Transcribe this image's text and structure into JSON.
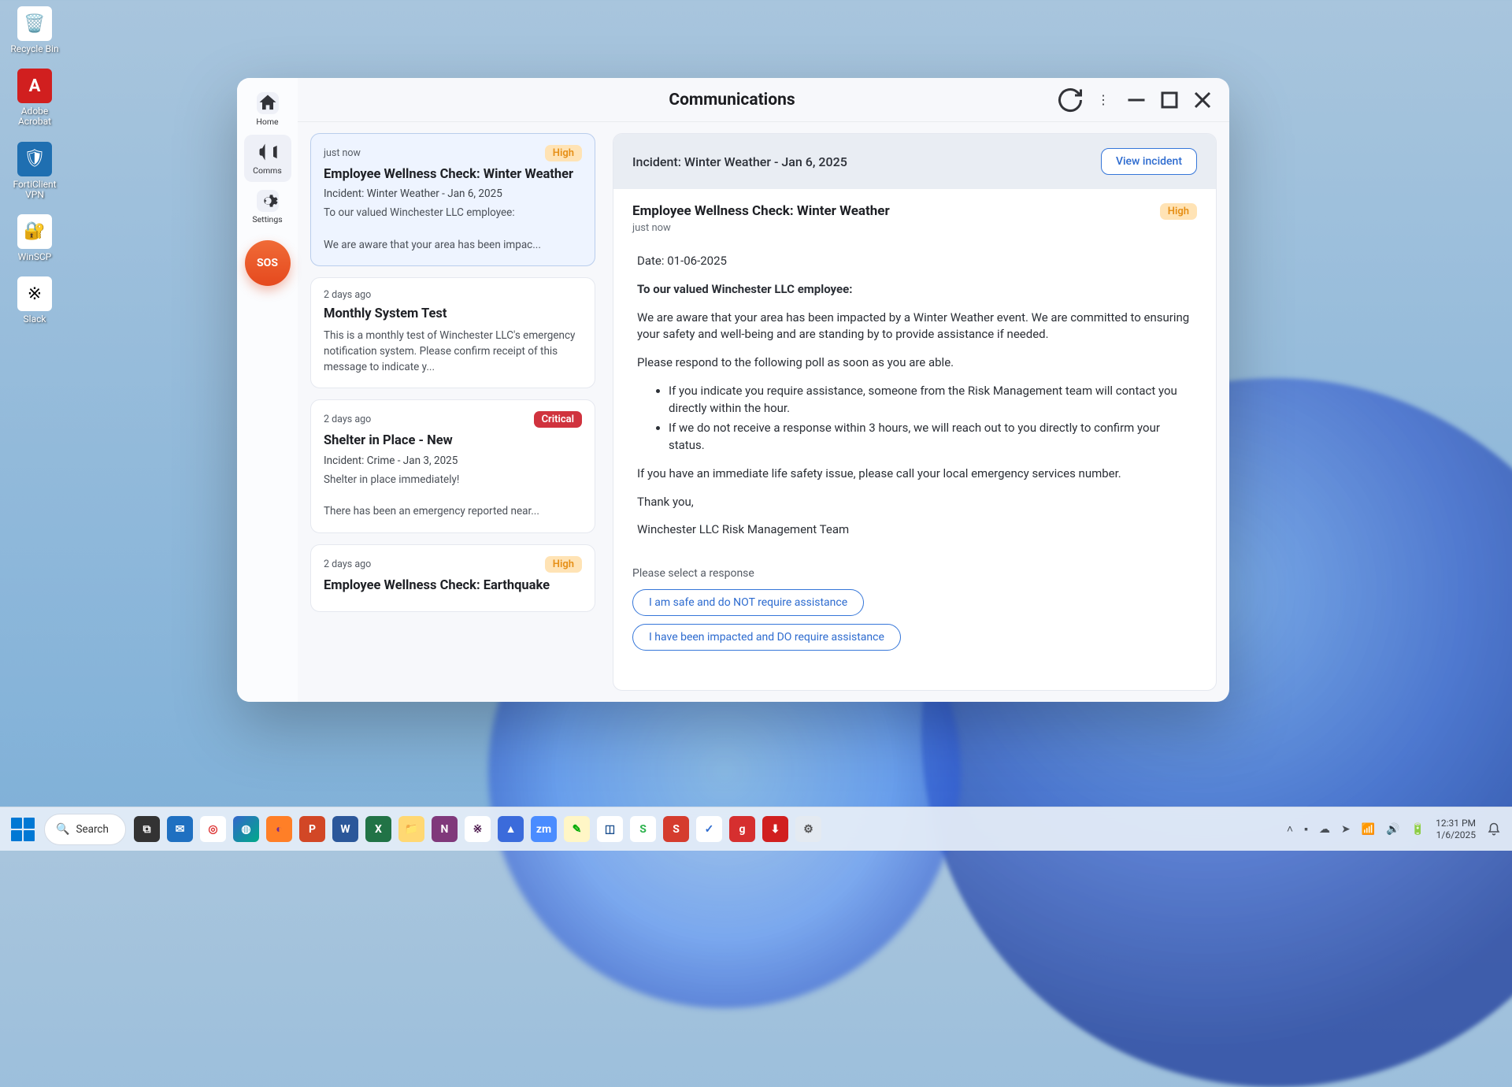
{
  "desktop": {
    "icons": [
      {
        "name": "recycle-bin",
        "label": "Recycle Bin"
      },
      {
        "name": "adobe-acrobat",
        "label": "Adobe Acrobat"
      },
      {
        "name": "forticlient-vpn",
        "label": "FortiClient VPN"
      },
      {
        "name": "winscp",
        "label": "WinSCP"
      },
      {
        "name": "slack",
        "label": "Slack"
      }
    ]
  },
  "window": {
    "title": "Communications",
    "sidebar": {
      "items": [
        {
          "name": "home",
          "label": "Home"
        },
        {
          "name": "comms",
          "label": "Comms"
        },
        {
          "name": "settings",
          "label": "Settings"
        }
      ],
      "sos": "SOS"
    },
    "list": [
      {
        "time": "just now",
        "badge": "High",
        "badge_level": "high",
        "title": "Employee Wellness Check: Winter Weather",
        "subtitle": "Incident: Winter Weather - Jan 6, 2025",
        "body": "To our valued Winchester LLC employee:\n\nWe are aware that your area has been impac...",
        "selected": true
      },
      {
        "time": "2 days ago",
        "badge": "",
        "badge_level": "",
        "title": "Monthly System Test",
        "subtitle": "",
        "body": "This is a monthly test of Winchester LLC's emergency notification system. Please confirm receipt of this message to indicate y...",
        "selected": false
      },
      {
        "time": "2 days ago",
        "badge": "Critical",
        "badge_level": "critical",
        "title": "Shelter in Place - New",
        "subtitle": "Incident: Crime - Jan 3, 2025",
        "body": "Shelter in place immediately!\n\nThere has been an emergency reported near...",
        "selected": false
      },
      {
        "time": "2 days ago",
        "badge": "High",
        "badge_level": "high",
        "title": "Employee Wellness Check: Earthquake",
        "subtitle": "",
        "body": "",
        "selected": false
      }
    ],
    "detail": {
      "incident_label": "Incident: Winter Weather - Jan 6, 2025",
      "view_incident": "View incident",
      "title": "Employee Wellness Check: Winter Weather",
      "time": "just now",
      "badge": "High",
      "body": {
        "date": "Date: 01-06-2025",
        "salutation": "To our valued Winchester LLC employee:",
        "p1": "We are aware that your area has been impacted by a Winter Weather event.  We are committed to ensuring your safety and well-being and are standing by to provide assistance if needed.",
        "p2": "Please respond to the following poll as soon as you are able.",
        "li1": "If you indicate you require assistance, someone from the Risk Management team will contact you directly within the hour.",
        "li2": "If we do not receive a response within 3 hours, we will reach out to you directly to confirm your status.",
        "p3": "If you have an immediate life safety issue, please call your local emergency services number.",
        "signoff": "Thank you,",
        "signer": "Winchester LLC Risk Management Team"
      },
      "response": {
        "prompt": "Please select a response",
        "opt1": "I am safe and do NOT require assistance",
        "opt2": "I have been impacted and DO require assistance"
      }
    }
  },
  "taskbar": {
    "search": "Search",
    "time": "12:31 PM",
    "date": "1/6/2025",
    "pins": [
      {
        "name": "task-view",
        "bg": "#333",
        "fg": "#fff",
        "glyph": "⧉"
      },
      {
        "name": "outlook",
        "bg": "#1f70c1",
        "fg": "#fff",
        "glyph": "✉"
      },
      {
        "name": "chrome",
        "bg": "#fff",
        "fg": "#d33",
        "glyph": "◎"
      },
      {
        "name": "edge",
        "bg": "linear-gradient(135deg,#36c,#0a8)",
        "fg": "#fff",
        "glyph": "◍"
      },
      {
        "name": "firefox",
        "bg": "#ff7f27",
        "fg": "#762a90",
        "glyph": "◐"
      },
      {
        "name": "powerpoint",
        "bg": "#d24726",
        "fg": "#fff",
        "glyph": "P"
      },
      {
        "name": "word",
        "bg": "#2b579a",
        "fg": "#fff",
        "glyph": "W"
      },
      {
        "name": "excel",
        "bg": "#217346",
        "fg": "#fff",
        "glyph": "X"
      },
      {
        "name": "explorer",
        "bg": "#ffd873",
        "fg": "#8a6b20",
        "glyph": "📁"
      },
      {
        "name": "onenote",
        "bg": "#80397b",
        "fg": "#fff",
        "glyph": "N"
      },
      {
        "name": "slack",
        "bg": "#fff",
        "fg": "#4a154b",
        "glyph": "※"
      },
      {
        "name": "app-blue",
        "bg": "#3b6bdb",
        "fg": "#fff",
        "glyph": "▲"
      },
      {
        "name": "zoom",
        "bg": "#4a8cff",
        "fg": "#fff",
        "glyph": "zm"
      },
      {
        "name": "notes",
        "bg": "#fff6c6",
        "fg": "#0a0",
        "glyph": "✎"
      },
      {
        "name": "app-duo",
        "bg": "#fff",
        "fg": "#1b4f8f",
        "glyph": "◫"
      },
      {
        "name": "snagit",
        "bg": "#fff",
        "fg": "#2bb24c",
        "glyph": "S"
      },
      {
        "name": "smartsheet",
        "bg": "#d53c2e",
        "fg": "#fff",
        "glyph": "S"
      },
      {
        "name": "comms-app",
        "bg": "#fff",
        "fg": "#2d6bcf",
        "glyph": "✓"
      },
      {
        "name": "grammarly",
        "bg": "#d62f2f",
        "fg": "#fff",
        "glyph": "g"
      },
      {
        "name": "pdf",
        "bg": "#d11f1f",
        "fg": "#fff",
        "glyph": "⬇"
      },
      {
        "name": "settings-gear",
        "bg": "#e4eaf1",
        "fg": "#555",
        "glyph": "⚙"
      }
    ]
  }
}
